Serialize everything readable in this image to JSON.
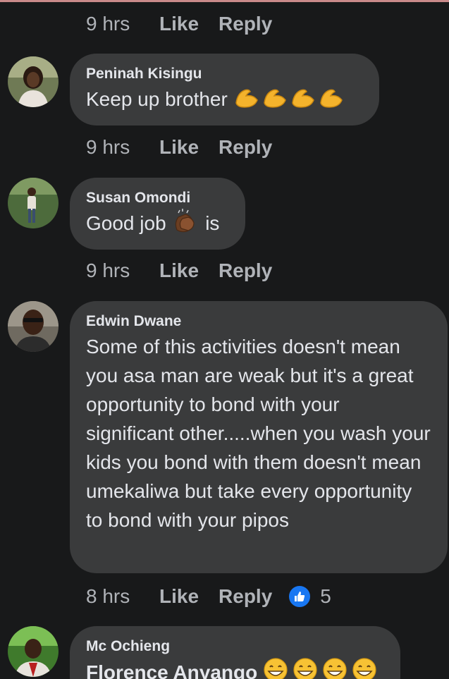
{
  "colors": {
    "background": "#18191a",
    "bubble": "#3a3b3c",
    "text": "#e4e6eb",
    "meta": "#b0b3b8",
    "like_blue": "#1877f2"
  },
  "top_actions": {
    "time": "9 hrs",
    "like": "Like",
    "reply": "Reply"
  },
  "comments": [
    {
      "author": "Peninah Kisingu",
      "text": "Keep up brother",
      "emoji": [
        "flexed-biceps",
        "flexed-biceps",
        "flexed-biceps",
        "flexed-biceps"
      ],
      "actions": {
        "time": "9 hrs",
        "like": "Like",
        "reply": "Reply"
      }
    },
    {
      "author": "Susan Omondi",
      "text_before": "Good job",
      "emoji": [
        "clapping-hands"
      ],
      "text_after": "is",
      "actions": {
        "time": "9 hrs",
        "like": "Like",
        "reply": "Reply"
      }
    },
    {
      "author": "Edwin Dwane",
      "text": "Some of this activities doesn't mean you asa man are weak but it's a great opportunity to bond with your significant other.....when you wash your kids you bond with them doesn't mean umekaliwa but take every opportunity to bond with your pipos",
      "actions": {
        "time": "8 hrs",
        "like": "Like",
        "reply": "Reply",
        "reaction_count": "5",
        "reaction_icon": "thumbs-up-icon"
      }
    },
    {
      "author": "Mc Ochieng",
      "text": "Florence Anyango",
      "emoji": [
        "grinning-face",
        "grinning-face",
        "grinning-face",
        "grinning-face"
      ]
    }
  ]
}
